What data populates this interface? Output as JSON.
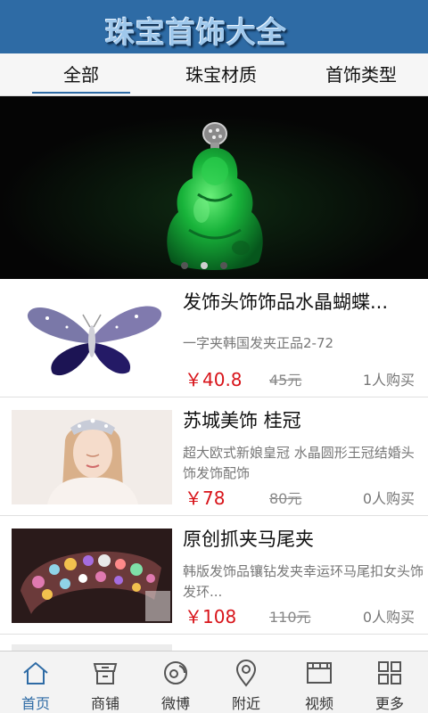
{
  "app": {
    "title": "珠宝首饰大全"
  },
  "tabs": [
    {
      "label": "全部",
      "active": true
    },
    {
      "label": "珠宝材质",
      "active": false
    },
    {
      "label": "首饰类型",
      "active": false
    }
  ],
  "banner": {
    "image": "green-jade-buddha-pendant",
    "slide_count": 3,
    "active_slide": 2
  },
  "products": [
    {
      "title": "发饰头饰饰品水晶蝴蝶...",
      "desc": "一字夹韩国发夹正品2-72",
      "price": "￥40.8",
      "old_price": "45元",
      "buyers": "1人购买",
      "image": "crystal-butterfly-hair-clip"
    },
    {
      "title": "苏城美饰 桂冠",
      "desc": "超大欧式新娘皇冠 水晶圆形王冠结婚头饰发饰配饰",
      "price": "￥78",
      "old_price": "80元",
      "buyers": "0人购买",
      "image": "bridal-crown"
    },
    {
      "title": "原创抓夹马尾夹",
      "desc": "韩版发饰品镶钻发夹幸运环马尾扣女头饰发环...",
      "price": "￥108",
      "old_price": "110元",
      "buyers": "0人购买",
      "image": "rhinestone-claw-clip"
    }
  ],
  "bottom_nav": [
    {
      "label": "首页",
      "icon": "home-icon",
      "active": true
    },
    {
      "label": "商铺",
      "icon": "shop-icon",
      "active": false
    },
    {
      "label": "微博",
      "icon": "weibo-icon",
      "active": false
    },
    {
      "label": "附近",
      "icon": "location-icon",
      "active": false
    },
    {
      "label": "视频",
      "icon": "video-icon",
      "active": false
    },
    {
      "label": "更多",
      "icon": "grid-icon",
      "active": false
    }
  ],
  "colors": {
    "header": "#2e6ba5",
    "price": "#d8141a",
    "accent": "#2e6ba5"
  }
}
